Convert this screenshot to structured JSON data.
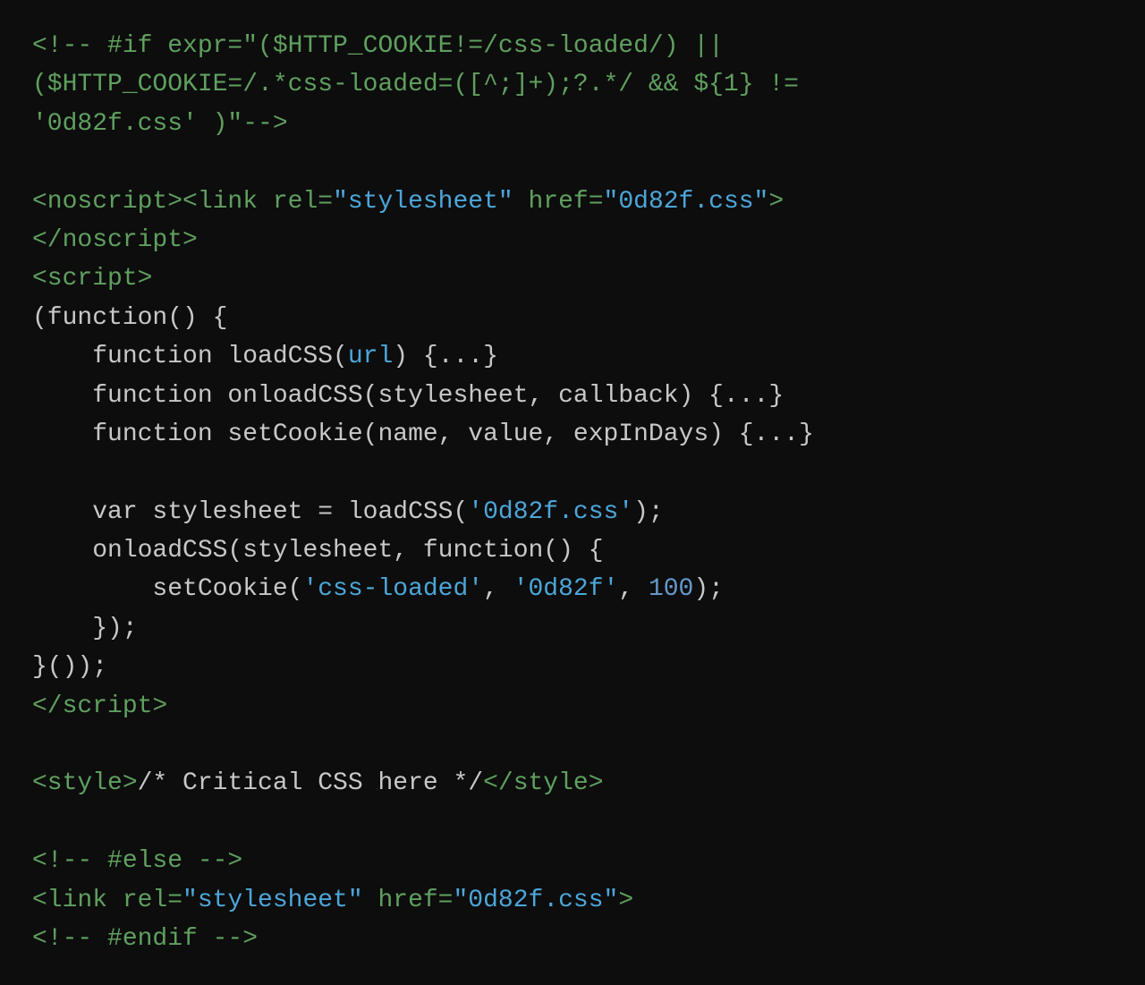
{
  "code": {
    "lines": [
      {
        "id": "line1"
      },
      {
        "id": "line2"
      },
      {
        "id": "line3"
      }
    ]
  }
}
